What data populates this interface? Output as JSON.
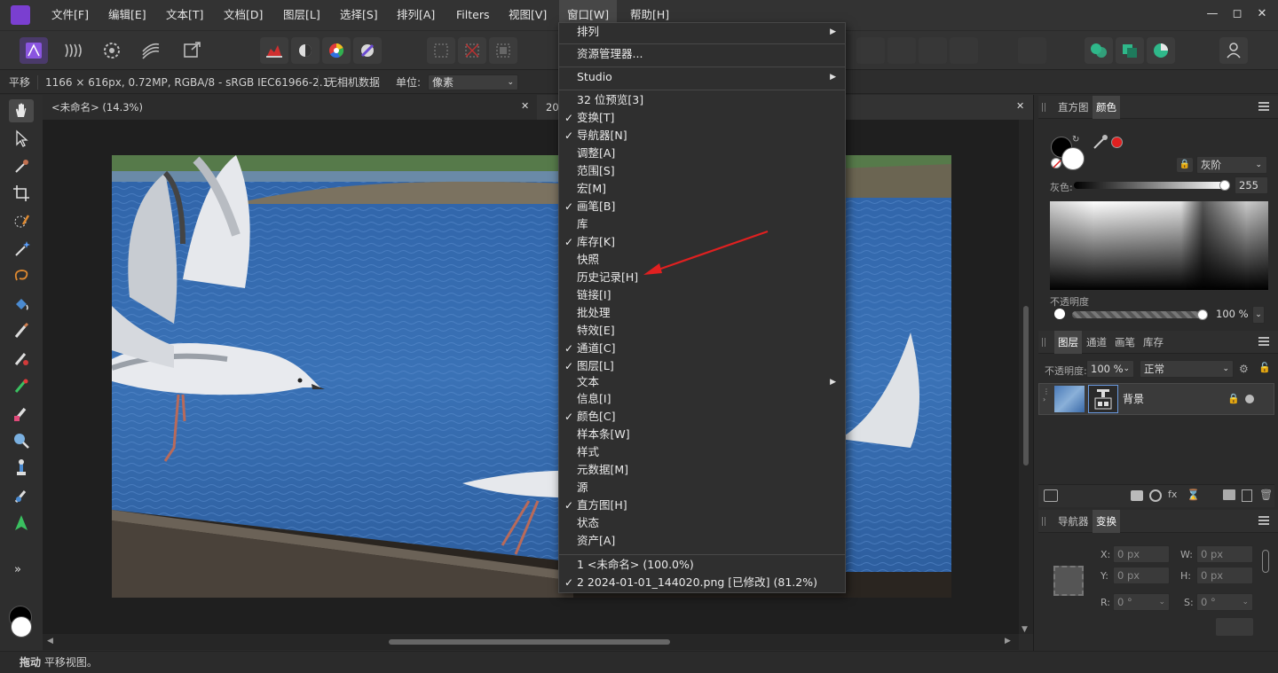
{
  "menubar": {
    "items": [
      {
        "label": "文件[F]"
      },
      {
        "label": "编辑[E]"
      },
      {
        "label": "文本[T]"
      },
      {
        "label": "文档[D]"
      },
      {
        "label": "图层[L]"
      },
      {
        "label": "选择[S]"
      },
      {
        "label": "排列[A]"
      },
      {
        "label": "Filters"
      },
      {
        "label": "视图[V]"
      },
      {
        "label": "窗口[W]"
      },
      {
        "label": "帮助[H]"
      }
    ],
    "active": "窗口[W]"
  },
  "context": {
    "mode": "平移",
    "doc_info": "1166 × 616px, 0.72MP, RGBA/8 - sRGB IEC61966-2.1",
    "camera": "无相机数据",
    "unit_label": "单位:",
    "unit_value": "像素"
  },
  "doc_tabs": [
    {
      "label": "<未命名> (14.3%)"
    },
    {
      "label": "20"
    }
  ],
  "window_menu": {
    "items": [
      {
        "label": "排列",
        "checked": false,
        "submenu": true
      },
      {
        "label": "资源管理器...",
        "checked": false,
        "submenu": false
      },
      {
        "label": "Studio",
        "checked": false,
        "submenu": true
      },
      {
        "label": "32 位预览[3]",
        "checked": false,
        "submenu": false
      },
      {
        "label": "变换[T]",
        "checked": true,
        "submenu": false
      },
      {
        "label": "导航器[N]",
        "checked": true,
        "submenu": false
      },
      {
        "label": "调整[A]",
        "checked": false,
        "submenu": false
      },
      {
        "label": "范围[S]",
        "checked": false,
        "submenu": false
      },
      {
        "label": "宏[M]",
        "checked": false,
        "submenu": false
      },
      {
        "label": "画笔[B]",
        "checked": true,
        "submenu": false
      },
      {
        "label": "库",
        "checked": false,
        "submenu": false
      },
      {
        "label": "库存[K]",
        "checked": true,
        "submenu": false
      },
      {
        "label": "快照",
        "checked": false,
        "submenu": false
      },
      {
        "label": "历史记录[H]",
        "checked": false,
        "submenu": false
      },
      {
        "label": "链接[I]",
        "checked": false,
        "submenu": false
      },
      {
        "label": "批处理",
        "checked": false,
        "submenu": false
      },
      {
        "label": "特效[E]",
        "checked": false,
        "submenu": false
      },
      {
        "label": "通道[C]",
        "checked": true,
        "submenu": false
      },
      {
        "label": "图层[L]",
        "checked": true,
        "submenu": false
      },
      {
        "label": "文本",
        "checked": false,
        "submenu": true
      },
      {
        "label": "信息[I]",
        "checked": false,
        "submenu": false
      },
      {
        "label": "颜色[C]",
        "checked": true,
        "submenu": false
      },
      {
        "label": "样本条[W]",
        "checked": false,
        "submenu": false
      },
      {
        "label": "样式",
        "checked": false,
        "submenu": false
      },
      {
        "label": "元数据[M]",
        "checked": false,
        "submenu": false
      },
      {
        "label": "源",
        "checked": false,
        "submenu": false
      },
      {
        "label": "直方图[H]",
        "checked": true,
        "submenu": false
      },
      {
        "label": "状态",
        "checked": false,
        "submenu": false
      },
      {
        "label": "资产[A]",
        "checked": false,
        "submenu": false
      },
      {
        "label": "1 <未命名> (100.0%)",
        "checked": false,
        "submenu": false
      },
      {
        "label": "2 2024-01-01_144020.png [已修改] (81.2%)",
        "checked": true,
        "submenu": false
      }
    ]
  },
  "color_panel": {
    "tabs": [
      "直方图",
      "颜色"
    ],
    "active_tab": "颜色",
    "mode": "灰阶",
    "gray_label": "灰色:",
    "gray_value": "255",
    "opacity_label": "不透明度",
    "opacity_value": "100 %"
  },
  "layers_panel": {
    "tabs": [
      "图层",
      "通道",
      "画笔",
      "库存"
    ],
    "active_tab": "图层",
    "opacity_label": "不透明度:",
    "opacity_value": "100 %",
    "blend_mode": "正常",
    "layer_name": "背景"
  },
  "transform_panel": {
    "tabs": [
      "导航器",
      "变换"
    ],
    "active_tab": "变换",
    "x_label": "X:",
    "x_value": "0 px",
    "w_label": "W:",
    "w_value": "0 px",
    "y_label": "Y:",
    "y_value": "0 px",
    "h_label": "H:",
    "h_value": "0 px",
    "r_label": "R:",
    "r_value": "0 °",
    "s_label": "S:",
    "s_value": "0 °"
  },
  "status": {
    "action": "拖动",
    "message": "平移视图。"
  },
  "colors": {
    "accent_red": "#e02020",
    "affinity_purple": "#7a3fd0",
    "water_blue": "#3a6fb0"
  }
}
